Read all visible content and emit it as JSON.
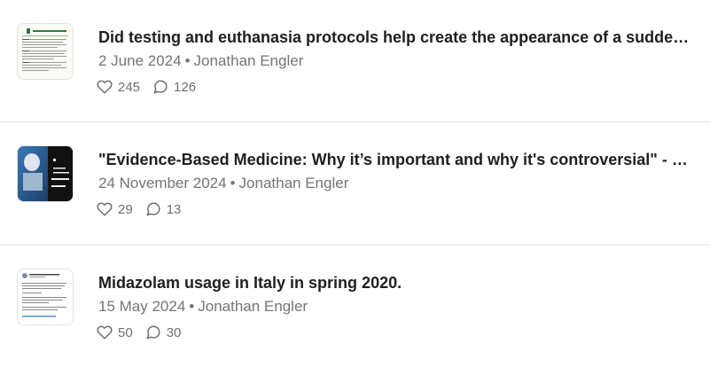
{
  "posts": [
    {
      "title": "Did testing and euthanasia protocols help create the appearance of a sudden-spr…",
      "date": "2 June 2024",
      "separator": "•",
      "author": "Jonathan Engler",
      "likes": "245",
      "comments": "126",
      "thumb_icon": "document-thumbnail-icon"
    },
    {
      "title": "\"Evidence-Based Medicine: Why it’s important and why it's controversial\" - Tom J…",
      "date": "24 November 2024",
      "separator": "•",
      "author": "Jonathan Engler",
      "likes": "29",
      "comments": "13",
      "thumb_icon": "video-thumbnail-icon"
    },
    {
      "title": "Midazolam usage in Italy in spring 2020.",
      "date": "15 May 2024",
      "separator": "•",
      "author": "Jonathan Engler",
      "likes": "50",
      "comments": "30",
      "thumb_icon": "tweet-thumbnail-icon"
    }
  ],
  "colors": {
    "title": "#202020",
    "meta": "#757575",
    "divider": "#e4e4e4"
  }
}
